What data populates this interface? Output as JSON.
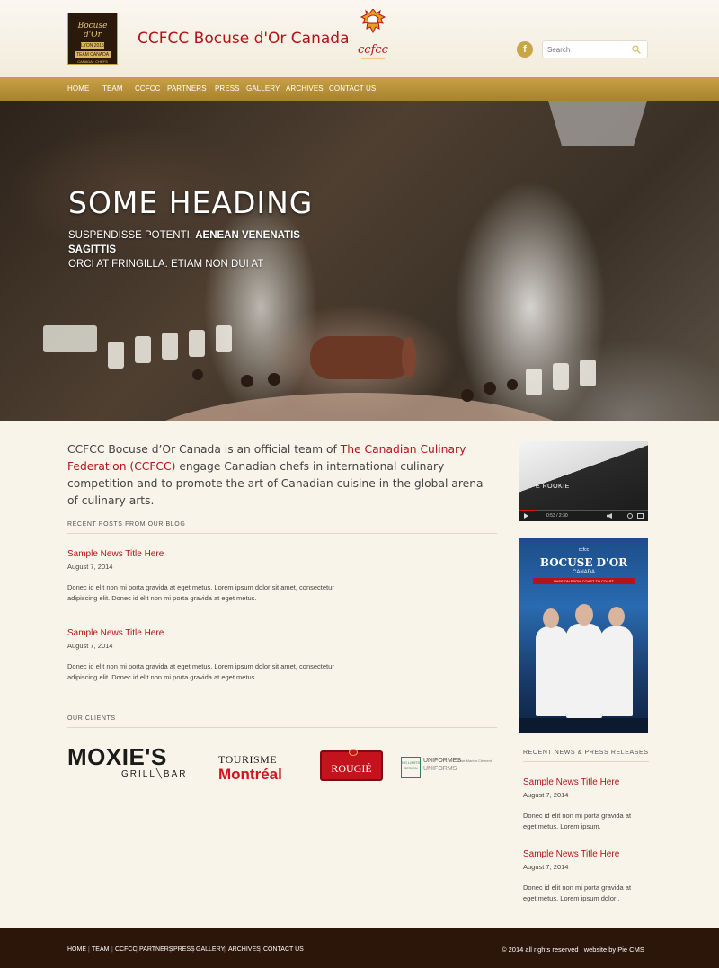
{
  "header": {
    "site_title": "CCFCC Bocuse d'Or Canada",
    "logo_bocuse": {
      "script": "Bocuse d'Or",
      "year": "LYON 2015",
      "team": "TEAM CANADA",
      "tagline": "CANADA · CHEFS"
    },
    "logo_ccfcc": "ccfcc",
    "facebook_icon_glyph": "f",
    "search": {
      "placeholder": "Search"
    }
  },
  "nav": {
    "items": [
      "HOME",
      "TEAM",
      "CCFCC",
      "PARTNERS",
      "PRESS",
      "GALLERY",
      "ARCHIVES",
      "CONTACT US"
    ]
  },
  "hero": {
    "heading": "SOME HEADING",
    "text_1": "SUSPENDISSE POTENTI. ",
    "text_bold": "AENEAN VENENATIS SAGITTIS",
    "text_2": "ORCI AT FRINGILLA. ETIAM NON DUI AT"
  },
  "intro": {
    "before": "CCFCC Bocuse d’Or Canada is an official team of ",
    "link": "The Canadian Culinary Federation (CCFCC)",
    "after": " engage Canadian chefs in international culinary competition and to promote the art of Canadian cuisine in the global arena of culinary arts."
  },
  "blog": {
    "label": "RECENT POSTS FROM OUR BLOG",
    "posts": [
      {
        "title": "Sample News Title Here",
        "date": "August 7, 2014",
        "body_1": "Donec id elit non mi porta gravida at eget metus. Lorem ipsum dolor sit amet, consectetur",
        "body_2": "adipiscing elit. Donec id elit non mi porta gravida at eget metus."
      },
      {
        "title": "Sample News Title Here",
        "date": "August 7, 2014",
        "body_1": "Donec id elit non mi porta gravida at eget metus. Lorem ipsum dolor sit amet, consectetur",
        "body_2": "adipiscing elit. Donec id elit non mi porta gravida at eget metus."
      }
    ]
  },
  "clients": {
    "label": "OUR CLIENTS",
    "moxies": {
      "name": "MOXIE'S",
      "sub": "GRILL╲BAR"
    },
    "tourisme": {
      "top": "TOURISME",
      "bottom": "Montréal"
    },
    "rougie": "ROUGIÉ",
    "nolimits": {
      "badge": "NO LIMITS DESIGN",
      "name_1": "UNIFORMES",
      "name_2": "UNIFORMS",
      "person": "Lise-Marina Clément"
    }
  },
  "sidebar": {
    "video_text": "E ROOKIE",
    "video_time": "0:53 / 2:30",
    "poster": {
      "top": "ccfcc",
      "title": "BOCUSE D'OR",
      "sub": "CANADA",
      "band": "— PASSION FROM COAST TO COAST —"
    },
    "news_label": "RECENT NEWS & PRESS RELEASES",
    "news": [
      {
        "title": "Sample News Title Here",
        "date": "August 7, 2014",
        "body_1": "Donec id elit non mi porta gravida at",
        "body_2": "eget metus. Lorem ipsum."
      },
      {
        "title": "Sample News Title Here",
        "date": "August 7, 2014",
        "body_1": "Donec id elit non mi porta gravida at",
        "body_2": "eget metus. Lorem ipsum dolor ."
      }
    ]
  },
  "footer": {
    "links": [
      "HOME",
      "TEAM",
      "CCFCC",
      "PARTNERS",
      "PRESS",
      "GALLERY",
      "ARCHIVES",
      "CONTACT US"
    ],
    "copyright": "© 2014 all rights reserved",
    "credit": "website by Pie CMS"
  },
  "colors": {
    "accent_red": "#b5121b",
    "nav_gold": "#b8902e",
    "footer_brown": "#2b1609",
    "background": "#f8f4ea"
  }
}
